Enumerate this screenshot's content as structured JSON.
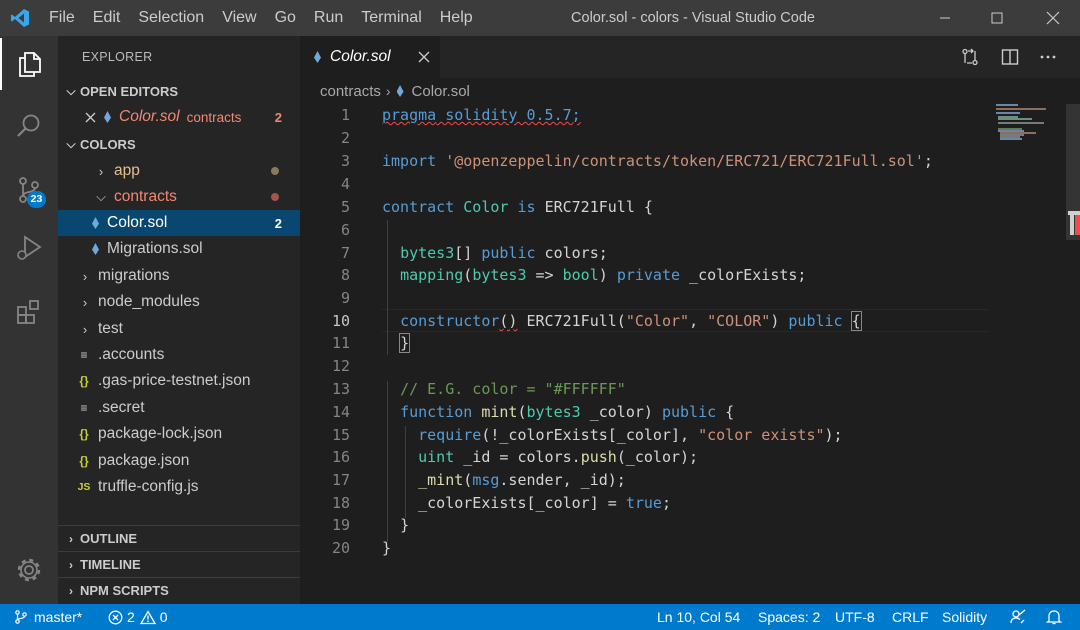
{
  "window": {
    "title": "Color.sol - colors - Visual Studio Code",
    "menu": [
      "File",
      "Edit",
      "Selection",
      "View",
      "Go",
      "Run",
      "Terminal",
      "Help"
    ]
  },
  "activity": {
    "scm_badge": "23"
  },
  "sidebar": {
    "title": "EXPLORER",
    "open_editors_label": "OPEN EDITORS",
    "open_editor": {
      "name": "Color.sol",
      "folder": "contracts",
      "problems": "2"
    },
    "project_label": "COLORS",
    "tree": [
      {
        "name": "app",
        "type": "folder",
        "indent": 0
      },
      {
        "name": "contracts",
        "type": "folder-open",
        "indent": 0
      },
      {
        "name": "Color.sol",
        "type": "sol",
        "indent": 1,
        "badge": "2"
      },
      {
        "name": "Migrations.sol",
        "type": "sol",
        "indent": 1
      },
      {
        "name": "migrations",
        "type": "folder",
        "indent": 0
      },
      {
        "name": "node_modules",
        "type": "folder",
        "indent": 0
      },
      {
        "name": "test",
        "type": "folder",
        "indent": 0
      },
      {
        "name": ".accounts",
        "type": "file",
        "indent": 0
      },
      {
        "name": ".gas-price-testnet.json",
        "type": "json",
        "indent": 0
      },
      {
        "name": ".secret",
        "type": "file",
        "indent": 0
      },
      {
        "name": "package-lock.json",
        "type": "json",
        "indent": 0
      },
      {
        "name": "package.json",
        "type": "json",
        "indent": 0
      },
      {
        "name": "truffle-config.js",
        "type": "js",
        "indent": 0
      }
    ],
    "outline_label": "OUTLINE",
    "timeline_label": "TIMELINE",
    "npm_label": "NPM SCRIPTS"
  },
  "editor": {
    "tab_label": "Color.sol",
    "breadcrumb": {
      "folder": "contracts",
      "file": "Color.sol"
    },
    "line_numbers": [
      "1",
      "2",
      "3",
      "4",
      "5",
      "6",
      "7",
      "8",
      "9",
      "10",
      "11",
      "12",
      "13",
      "14",
      "15",
      "16",
      "17",
      "18",
      "19",
      "20"
    ],
    "code": {
      "pragma_kw": "pragma",
      "pragma_rest": " solidity 0.5.7;",
      "import_kw": "import",
      "import_path": "'@openzeppelin/contracts/token/ERC721/ERC721Full.sol'",
      "semicolon": ";",
      "contract_kw": "contract",
      "contract_name": "Color",
      "is_kw": "is",
      "parent": "ERC721Full {",
      "l7_type": "bytes3",
      "l7_mid": "[] ",
      "l7_public": "public",
      "l7_rest": " colors;",
      "l8_mapping": "mapping",
      "l8_open": "(",
      "l8_bytes": "bytes3",
      "l8_arrow": " => ",
      "l8_bool": "bool",
      "l8_close": ") ",
      "l8_private": "private",
      "l8_rest": " _colorExists;",
      "l10_ctor": "constructor",
      "l10_paren": "()",
      "l10_call": " ERC721Full(",
      "l10_s1": "\"Color\"",
      "l10_comma": ", ",
      "l10_s2": "\"COLOR\"",
      "l10_close": ") ",
      "l10_public": "public",
      "l10_brace": "{",
      "l11_brace": "}",
      "l13_comment": "// E.G. color = \"#FFFFFF\"",
      "l14_function": "function",
      "l14_name": "mint",
      "l14_open": "(",
      "l14_bytes": "bytes3",
      "l14_mid": " _color) ",
      "l14_public": "public",
      "l14_brace": " {",
      "l15_require": "require",
      "l15_mid": "(!_colorExists[_color], ",
      "l15_str": "\"color exists\"",
      "l15_end": ");",
      "l16_uint": "uint",
      "l16_rest": " _id = colors.",
      "l16_push": "push",
      "l16_end": "(_color);",
      "l17_mint": "_mint",
      "l17_open": "(",
      "l17_msg": "msg",
      "l17_rest": ".sender, _id);",
      "l18_rest": "_colorExists[_color] = ",
      "l18_true": "true",
      "l18_end": ";",
      "l19_brace": "}",
      "l20_brace": "}"
    }
  },
  "statusbar": {
    "branch": "master*",
    "errors": "2",
    "warnings": "0",
    "position": "Ln 10, Col 54",
    "spaces": "Spaces: 2",
    "encoding": "UTF-8",
    "eol": "CRLF",
    "language": "Solidity"
  },
  "colors": {
    "accent": "#007acc",
    "selection": "#094771",
    "error": "#f14c4c",
    "git_modified": "#e2c08d"
  }
}
